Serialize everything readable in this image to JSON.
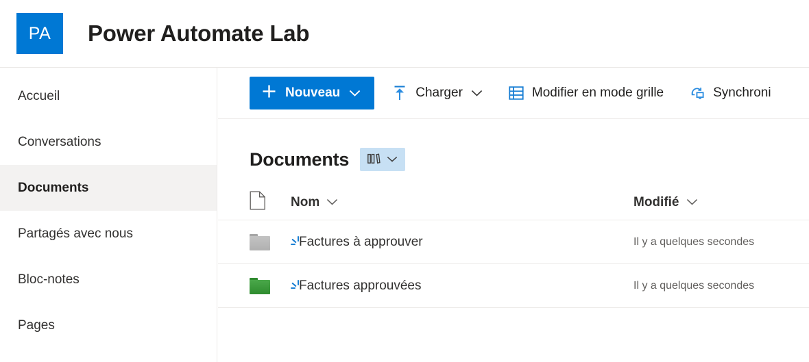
{
  "header": {
    "logo_initials": "PA",
    "logo_color": "#0078D4",
    "site_title": "Power Automate Lab"
  },
  "sidebar": {
    "items": [
      {
        "label": "Accueil",
        "name": "accueil",
        "selected": false
      },
      {
        "label": "Conversations",
        "name": "conversations",
        "selected": false
      },
      {
        "label": "Documents",
        "name": "documents",
        "selected": true
      },
      {
        "label": "Partagés avec nous",
        "name": "partages-avec-nous",
        "selected": false
      },
      {
        "label": "Bloc-notes",
        "name": "bloc-notes",
        "selected": false
      },
      {
        "label": "Pages",
        "name": "pages",
        "selected": false
      }
    ]
  },
  "command_bar": {
    "new_button": {
      "label": "Nouveau",
      "icon": "plus-icon",
      "chevron": "chevron-down-icon"
    },
    "commands": [
      {
        "label": "Charger",
        "icon": "upload-icon",
        "has_chevron": true
      },
      {
        "label": "Modifier en mode grille",
        "icon": "grid-edit-icon",
        "has_chevron": false
      },
      {
        "label": "Synchroni",
        "icon": "sync-icon",
        "has_chevron": false
      }
    ]
  },
  "list": {
    "title": "Documents",
    "view_switcher": {
      "icon": "list-view-icon",
      "chevron": "chevron-down-icon",
      "background": "#C7E0F4"
    },
    "columns": [
      {
        "key": "icon",
        "label": "",
        "has_chevron": false
      },
      {
        "key": "name",
        "label": "Nom",
        "has_chevron": true
      },
      {
        "key": "modified",
        "label": "Modifié",
        "has_chevron": true
      }
    ],
    "rows": [
      {
        "name": "Factures à approuver",
        "modified": "Il y a quelques secondes",
        "icon": "folder-icon",
        "folder_color": "gray",
        "status_icon": "loading-spinner-icon"
      },
      {
        "name": "Factures approuvées",
        "modified": "Il y a quelques secondes",
        "icon": "folder-icon",
        "folder_color": "green",
        "status_icon": "loading-spinner-icon"
      }
    ]
  }
}
